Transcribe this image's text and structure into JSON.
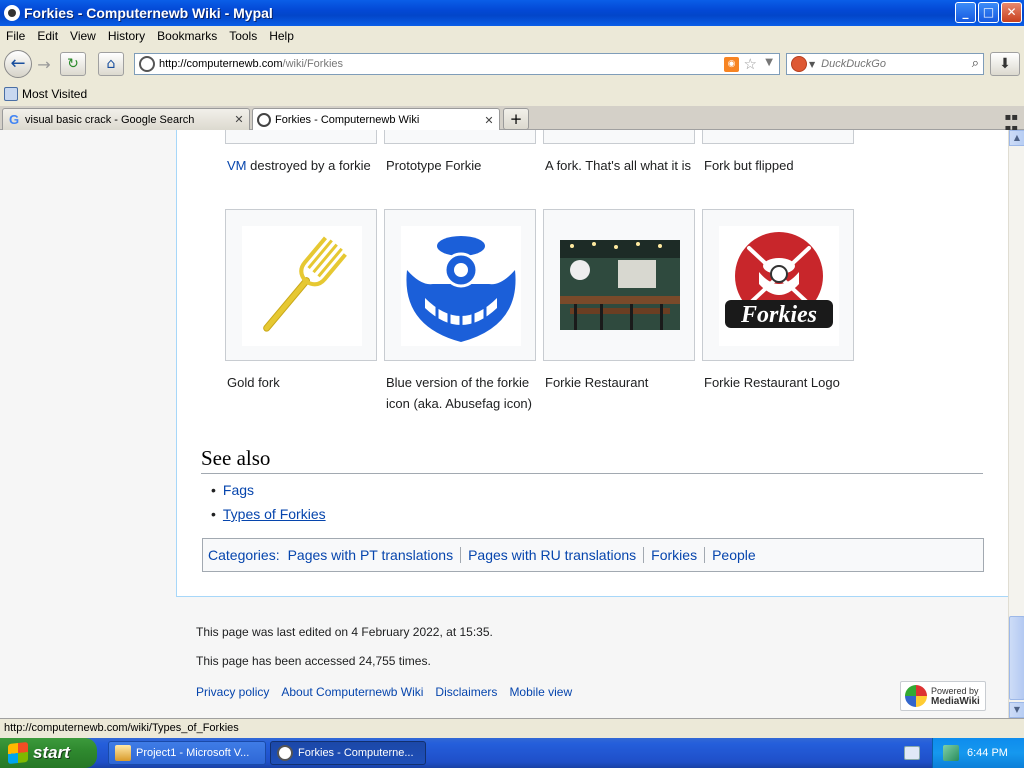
{
  "window": {
    "title": "Forkies - Computernewb Wiki - Mypal",
    "minimize": "_",
    "maximize": "□",
    "close": "✕"
  },
  "menu": [
    "File",
    "Edit",
    "View",
    "History",
    "Bookmarks",
    "Tools",
    "Help"
  ],
  "nav": {
    "url_host": "http://computernewb.com",
    "url_path": "/wiki/Forkies",
    "search_placeholder": "DuckDuckGo"
  },
  "bookmarks": {
    "most_visited": "Most Visited"
  },
  "tabs": [
    {
      "label": "visual basic crack - Google Search",
      "active": false
    },
    {
      "label": "Forkies - Computernewb Wiki",
      "active": true
    }
  ],
  "gallery_top": [
    {
      "caption_link": "VM",
      "caption": " destroyed by a forkie"
    },
    {
      "caption": "Prototype Forkie"
    },
    {
      "caption": "A fork. That's all what it is"
    },
    {
      "caption": "Fork but flipped"
    }
  ],
  "gallery": [
    {
      "caption": "Gold fork"
    },
    {
      "caption": "Blue version of the forkie icon (aka. Abusefag icon)"
    },
    {
      "caption": "Forkie Restaurant"
    },
    {
      "caption": "Forkie Restaurant Logo"
    }
  ],
  "logo_text": "Forkies",
  "see_also": {
    "heading": "See also",
    "items": [
      "Fags",
      "Types of Forkies"
    ]
  },
  "categories": {
    "label": "Categories:",
    "items": [
      "Pages with PT translations",
      "Pages with RU translations",
      "Forkies",
      "People"
    ]
  },
  "footer": {
    "last_edited": "This page was last edited on 4 February 2022, at 15:35.",
    "accessed": "This page has been accessed 24,755 times.",
    "links": [
      "Privacy policy",
      "About Computernewb Wiki",
      "Disclaimers",
      "Mobile view"
    ],
    "powered_line1": "Powered by",
    "powered_line2": "MediaWiki"
  },
  "status_text": "http://computernewb.com/wiki/Types_of_Forkies",
  "taskbar": {
    "start": "start",
    "tasks": [
      {
        "label": "Project1 - Microsoft V..."
      },
      {
        "label": "Forkies - Computerne..."
      }
    ],
    "clock": "6:44 PM"
  },
  "colors": {
    "link": "#0645ad",
    "forkie_blue": "#1b5fd9",
    "logo_red": "#c8262b",
    "gold": "#e6c832"
  }
}
